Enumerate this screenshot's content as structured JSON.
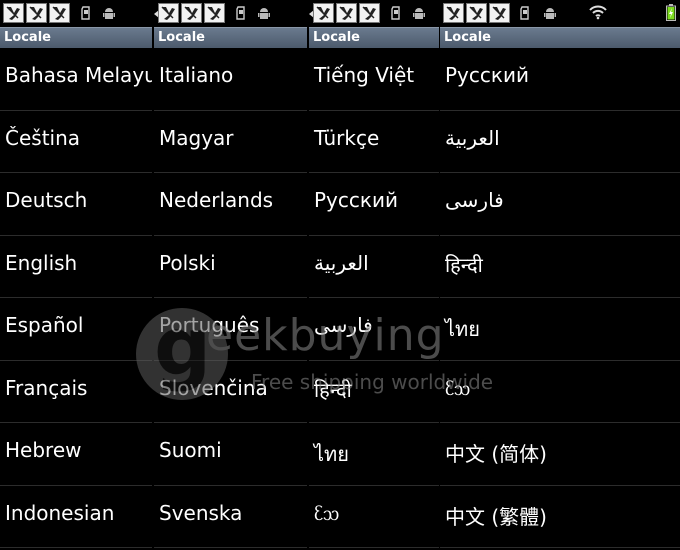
{
  "panels": [
    {
      "title": "Locale",
      "items": [
        "Bahasa Melayu",
        "Čeština",
        "Deutsch",
        "English",
        "Español",
        "Français",
        "Hebrew",
        "Indonesian"
      ]
    },
    {
      "title": "Locale",
      "items": [
        "Italiano",
        "Magyar",
        "Nederlands",
        "Polski",
        "Português",
        "Slovenčina",
        "Suomi",
        "Svenska"
      ]
    },
    {
      "title": "Locale",
      "items": [
        "Tiếng Việt",
        "Türkçe",
        "Русский",
        "العربية",
        "فارسی",
        "हिन्दी",
        "ไทย",
        "ᦷᦉ"
      ]
    },
    {
      "title": "Locale",
      "items": [
        "Русский",
        "العربية",
        "فارسی",
        "हिन्दी",
        "ไทย",
        "ᦷᦉ",
        "中文 (简体)",
        "中文 (繁體)"
      ]
    }
  ],
  "watermark": {
    "brand": "eekbuying",
    "letter": "g",
    "tagline": "Free shipping worldwide"
  },
  "icons": {
    "notification": "usb-debug-notification-icon",
    "sd": "sd-card-icon",
    "android": "android-debug-icon",
    "wifi": "wifi-icon",
    "battery": "battery-charging-icon"
  },
  "colors": {
    "titlebar": "#56657a",
    "background": "#000000",
    "battery": "#7ddc1f"
  }
}
